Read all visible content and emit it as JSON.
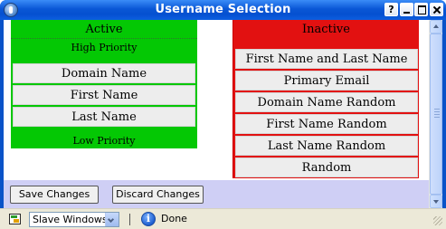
{
  "window": {
    "title": "Username Selection",
    "help_glyph": "?"
  },
  "active_panel": {
    "title": "Active",
    "high_priority_label": "High Priority",
    "low_priority_label": "Low Priority",
    "items": [
      "Domain Name",
      "First Name",
      "Last Name"
    ],
    "color": "#04c804"
  },
  "inactive_panel": {
    "title": "Inactive",
    "items": [
      "First Name and Last Name",
      "Primary Email",
      "Domain Name Random",
      "First Name Random",
      "Last Name Random",
      "Random"
    ],
    "color": "#e21111"
  },
  "buttons": {
    "save_label": "Save Changes",
    "discard_label": "Discard Changes"
  },
  "statusbar": {
    "dropdown_value": "Slave Windows",
    "status_text": "Done",
    "info_glyph": "i"
  },
  "icons": [
    "app-icon",
    "help-icon",
    "minimize-icon",
    "maximize-icon",
    "close-icon",
    "scroll-up-arrow-icon",
    "scroll-down-arrow-icon",
    "slave-windows-icon",
    "dropdown-arrow-icon",
    "info-icon",
    "resize-grip-icon"
  ],
  "colors": {
    "titlebar": "#0a57d6",
    "button_bar": "#cfcff5",
    "statusbar": "#ece9d8"
  }
}
